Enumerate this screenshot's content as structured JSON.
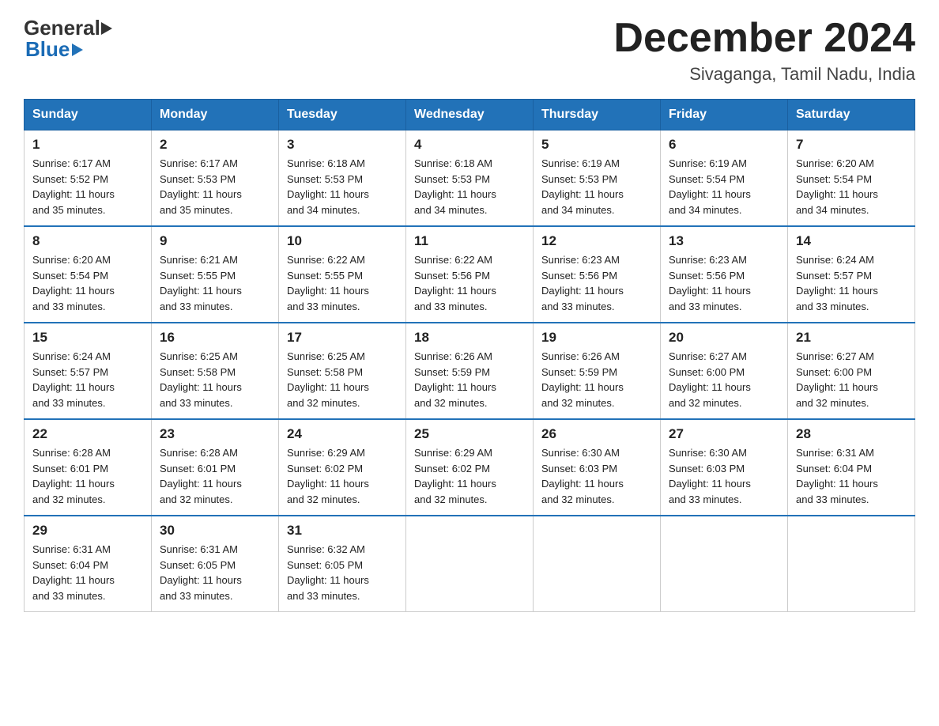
{
  "header": {
    "logo_general": "General",
    "logo_blue": "Blue",
    "month_title": "December 2024",
    "location": "Sivaganga, Tamil Nadu, India"
  },
  "days_of_week": [
    "Sunday",
    "Monday",
    "Tuesday",
    "Wednesday",
    "Thursday",
    "Friday",
    "Saturday"
  ],
  "weeks": [
    {
      "days": [
        {
          "num": "1",
          "sunrise": "6:17 AM",
          "sunset": "5:52 PM",
          "daylight": "11 hours and 35 minutes."
        },
        {
          "num": "2",
          "sunrise": "6:17 AM",
          "sunset": "5:53 PM",
          "daylight": "11 hours and 35 minutes."
        },
        {
          "num": "3",
          "sunrise": "6:18 AM",
          "sunset": "5:53 PM",
          "daylight": "11 hours and 34 minutes."
        },
        {
          "num": "4",
          "sunrise": "6:18 AM",
          "sunset": "5:53 PM",
          "daylight": "11 hours and 34 minutes."
        },
        {
          "num": "5",
          "sunrise": "6:19 AM",
          "sunset": "5:53 PM",
          "daylight": "11 hours and 34 minutes."
        },
        {
          "num": "6",
          "sunrise": "6:19 AM",
          "sunset": "5:54 PM",
          "daylight": "11 hours and 34 minutes."
        },
        {
          "num": "7",
          "sunrise": "6:20 AM",
          "sunset": "5:54 PM",
          "daylight": "11 hours and 34 minutes."
        }
      ]
    },
    {
      "days": [
        {
          "num": "8",
          "sunrise": "6:20 AM",
          "sunset": "5:54 PM",
          "daylight": "11 hours and 33 minutes."
        },
        {
          "num": "9",
          "sunrise": "6:21 AM",
          "sunset": "5:55 PM",
          "daylight": "11 hours and 33 minutes."
        },
        {
          "num": "10",
          "sunrise": "6:22 AM",
          "sunset": "5:55 PM",
          "daylight": "11 hours and 33 minutes."
        },
        {
          "num": "11",
          "sunrise": "6:22 AM",
          "sunset": "5:56 PM",
          "daylight": "11 hours and 33 minutes."
        },
        {
          "num": "12",
          "sunrise": "6:23 AM",
          "sunset": "5:56 PM",
          "daylight": "11 hours and 33 minutes."
        },
        {
          "num": "13",
          "sunrise": "6:23 AM",
          "sunset": "5:56 PM",
          "daylight": "11 hours and 33 minutes."
        },
        {
          "num": "14",
          "sunrise": "6:24 AM",
          "sunset": "5:57 PM",
          "daylight": "11 hours and 33 minutes."
        }
      ]
    },
    {
      "days": [
        {
          "num": "15",
          "sunrise": "6:24 AM",
          "sunset": "5:57 PM",
          "daylight": "11 hours and 33 minutes."
        },
        {
          "num": "16",
          "sunrise": "6:25 AM",
          "sunset": "5:58 PM",
          "daylight": "11 hours and 33 minutes."
        },
        {
          "num": "17",
          "sunrise": "6:25 AM",
          "sunset": "5:58 PM",
          "daylight": "11 hours and 32 minutes."
        },
        {
          "num": "18",
          "sunrise": "6:26 AM",
          "sunset": "5:59 PM",
          "daylight": "11 hours and 32 minutes."
        },
        {
          "num": "19",
          "sunrise": "6:26 AM",
          "sunset": "5:59 PM",
          "daylight": "11 hours and 32 minutes."
        },
        {
          "num": "20",
          "sunrise": "6:27 AM",
          "sunset": "6:00 PM",
          "daylight": "11 hours and 32 minutes."
        },
        {
          "num": "21",
          "sunrise": "6:27 AM",
          "sunset": "6:00 PM",
          "daylight": "11 hours and 32 minutes."
        }
      ]
    },
    {
      "days": [
        {
          "num": "22",
          "sunrise": "6:28 AM",
          "sunset": "6:01 PM",
          "daylight": "11 hours and 32 minutes."
        },
        {
          "num": "23",
          "sunrise": "6:28 AM",
          "sunset": "6:01 PM",
          "daylight": "11 hours and 32 minutes."
        },
        {
          "num": "24",
          "sunrise": "6:29 AM",
          "sunset": "6:02 PM",
          "daylight": "11 hours and 32 minutes."
        },
        {
          "num": "25",
          "sunrise": "6:29 AM",
          "sunset": "6:02 PM",
          "daylight": "11 hours and 32 minutes."
        },
        {
          "num": "26",
          "sunrise": "6:30 AM",
          "sunset": "6:03 PM",
          "daylight": "11 hours and 32 minutes."
        },
        {
          "num": "27",
          "sunrise": "6:30 AM",
          "sunset": "6:03 PM",
          "daylight": "11 hours and 33 minutes."
        },
        {
          "num": "28",
          "sunrise": "6:31 AM",
          "sunset": "6:04 PM",
          "daylight": "11 hours and 33 minutes."
        }
      ]
    },
    {
      "days": [
        {
          "num": "29",
          "sunrise": "6:31 AM",
          "sunset": "6:04 PM",
          "daylight": "11 hours and 33 minutes."
        },
        {
          "num": "30",
          "sunrise": "6:31 AM",
          "sunset": "6:05 PM",
          "daylight": "11 hours and 33 minutes."
        },
        {
          "num": "31",
          "sunrise": "6:32 AM",
          "sunset": "6:05 PM",
          "daylight": "11 hours and 33 minutes."
        },
        null,
        null,
        null,
        null
      ]
    }
  ],
  "labels": {
    "sunrise": "Sunrise:",
    "sunset": "Sunset:",
    "daylight": "Daylight:"
  }
}
